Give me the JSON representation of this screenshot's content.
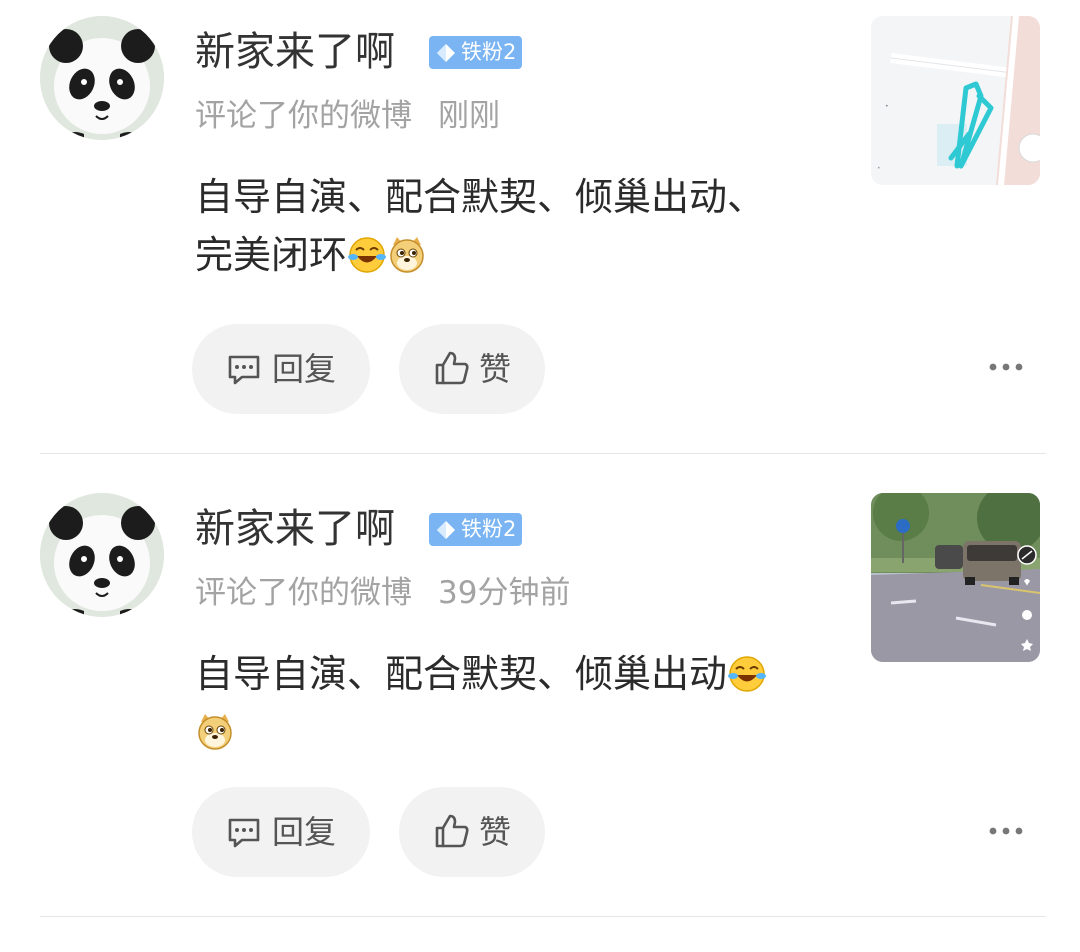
{
  "notifications": [
    {
      "user_name": "新家来了啊",
      "badge_label": "铁粉2",
      "action_text": "评论了你的微博",
      "time": "刚刚",
      "content_lines": [
        "自导自演、配合默契、倾巢出动、",
        "完美闭环"
      ],
      "emojis": [
        "laugh-cry-emoji",
        "doge-emoji"
      ],
      "thumbnail": "map-route-thumbnail",
      "reply_label": "回复",
      "like_label": "赞"
    },
    {
      "user_name": "新家来了啊",
      "badge_label": "铁粉2",
      "action_text": "评论了你的微博",
      "time": "39分钟前",
      "content_lines": [
        "自导自演、配合默契、倾巢出动"
      ],
      "emojis": [
        "laugh-cry-emoji",
        "doge-emoji"
      ],
      "thumbnail": "street-car-video-thumbnail",
      "reply_label": "回复",
      "like_label": "赞"
    }
  ],
  "colors": {
    "badge": "#7ab4f2",
    "meta_text": "#a3a3a3",
    "button_bg": "#f2f2f2",
    "route_line": "#2ec9d3"
  }
}
